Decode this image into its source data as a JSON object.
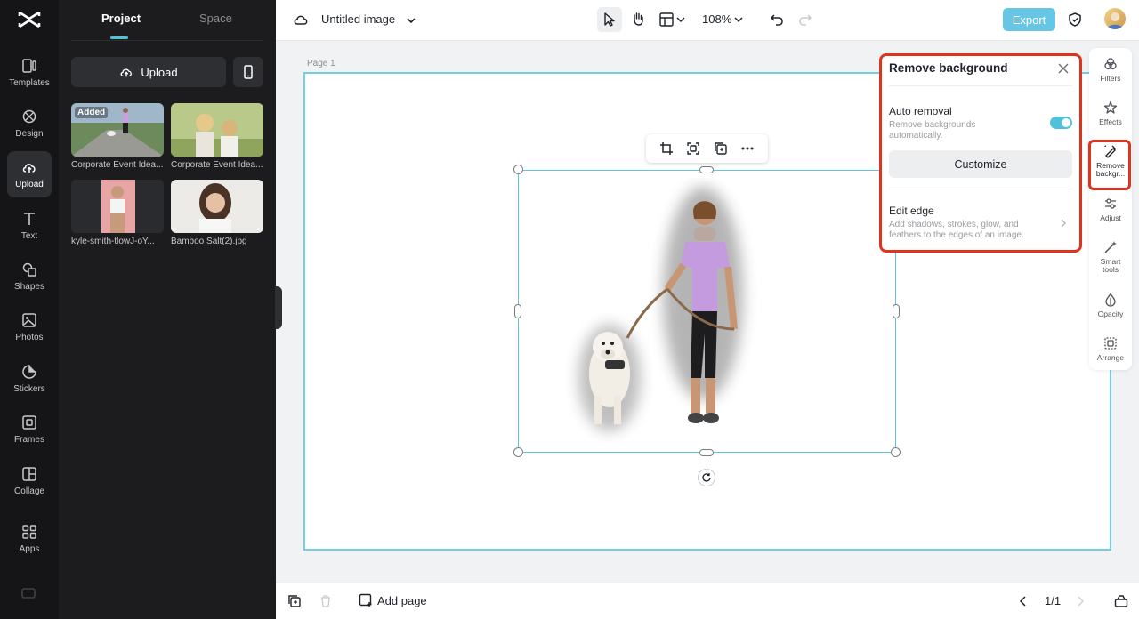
{
  "left_nav": {
    "items": [
      {
        "label": "Templates",
        "icon": "templates-icon"
      },
      {
        "label": "Design",
        "icon": "design-icon"
      },
      {
        "label": "Upload",
        "icon": "upload-cloud-icon",
        "active": true
      },
      {
        "label": "Text",
        "icon": "text-icon"
      },
      {
        "label": "Shapes",
        "icon": "shapes-icon"
      },
      {
        "label": "Photos",
        "icon": "photos-icon"
      },
      {
        "label": "Stickers",
        "icon": "stickers-icon"
      },
      {
        "label": "Frames",
        "icon": "frames-icon"
      },
      {
        "label": "Collage",
        "icon": "collage-icon"
      },
      {
        "label": "Apps",
        "icon": "apps-icon"
      }
    ]
  },
  "panel": {
    "tabs": [
      {
        "label": "Project",
        "active": true
      },
      {
        "label": "Space"
      }
    ],
    "upload_label": "Upload",
    "media": [
      {
        "label": "Corporate Event Idea...",
        "badge": "Added"
      },
      {
        "label": "Corporate Event Idea..."
      },
      {
        "label": "kyle-smith-tlowJ-oY..."
      },
      {
        "label": "Bamboo Salt(2).jpg"
      }
    ]
  },
  "topbar": {
    "title": "Untitled image",
    "zoom": "108%",
    "export_label": "Export"
  },
  "canvas": {
    "page_label": "Page 1"
  },
  "right_toolbar": {
    "items": [
      {
        "label": "Filters",
        "icon": "filters-icon"
      },
      {
        "label": "Effects",
        "icon": "effects-icon"
      },
      {
        "label": "Remove backgr...",
        "icon": "remove-background-icon",
        "active": true
      },
      {
        "label": "Adjust",
        "icon": "adjust-icon"
      },
      {
        "label": "Smart tools",
        "icon": "smart-tools-icon"
      },
      {
        "label": "Opacity",
        "icon": "opacity-icon"
      },
      {
        "label": "Arrange",
        "icon": "arrange-icon"
      }
    ]
  },
  "remove_bg_panel": {
    "title": "Remove background",
    "auto_removal_title": "Auto removal",
    "auto_removal_desc": "Remove backgrounds automatically.",
    "auto_removal_enabled": true,
    "customize_label": "Customize",
    "edit_edge_title": "Edit edge",
    "edit_edge_desc": "Add shadows, strokes, glow, and feathers to the edges of an image."
  },
  "bottombar": {
    "add_page_label": "Add page",
    "page_count": "1/1"
  },
  "colors": {
    "accent": "#4fc1d9",
    "highlight": "#e0331c",
    "export": "#67c6e6"
  }
}
